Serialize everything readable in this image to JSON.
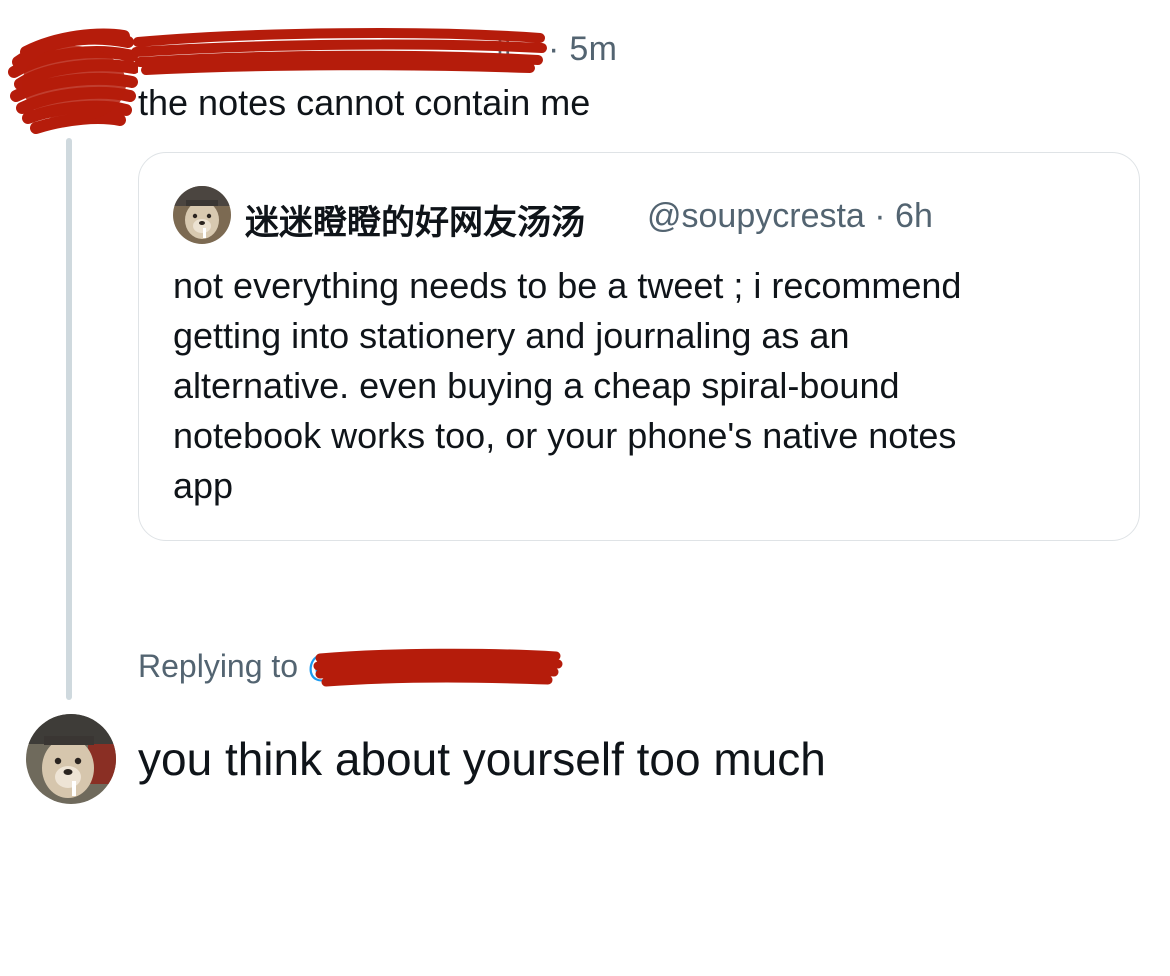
{
  "top_tweet": {
    "name_fragment": "fl",
    "meta": "· 5m",
    "text": "the notes cannot contain me"
  },
  "quoted_tweet": {
    "display_name": "迷迷瞪瞪的好网友汤汤",
    "handle_time": "@soupycresta · 6h",
    "body_lines": [
      "not everything needs to be a tweet ; i recommend",
      "getting into stationery and journaling as an",
      "alternative. even buying a cheap spiral-bound",
      "notebook works too, or your phone's native notes",
      "app"
    ]
  },
  "reply": {
    "replying_label": "Replying to",
    "replying_at": "@",
    "text": "you think about yourself too much"
  },
  "colors": {
    "redaction": "#b51c0b",
    "secondary_text": "#536471",
    "primary_text": "#0f1419",
    "link": "#1d9bf0",
    "thread_line": "#cfd9de",
    "card_border": "#dfe3e6"
  }
}
